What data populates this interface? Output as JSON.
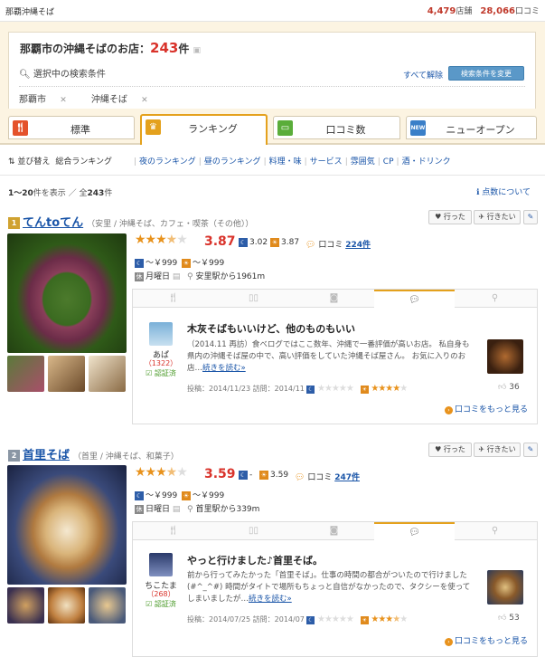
{
  "header": {
    "title": "那覇沖縄そば",
    "shops_count": "4,479",
    "shops_unit": "店舗",
    "reviews_count": "28,066",
    "reviews_unit": "口コミ"
  },
  "search": {
    "heading_prefix": "那覇市の沖縄そばのお店：",
    "count": "243",
    "heading_suffix": "件",
    "conditions_label": "選択中の検索条件",
    "clear_all": "すべて解除",
    "change_conditions": "検索条件を変更",
    "tags": [
      "那覇市",
      "沖縄そば"
    ]
  },
  "tabs": [
    {
      "label": "標準",
      "icon": "fork-knife-icon",
      "color": "#e4522b"
    },
    {
      "label": "ランキング",
      "icon": "crown-icon",
      "color": "#e4a11d",
      "active": true
    },
    {
      "label": "口コミ数",
      "icon": "speech-bubble-icon",
      "color": "#5aad3a"
    },
    {
      "label": "ニューオープン",
      "icon": "new-badge-icon",
      "color": "#3a7fc8"
    }
  ],
  "sort": {
    "label": "並び替え",
    "current": "総合ランキング",
    "options": [
      "夜のランキング",
      "昼のランキング",
      "料理・味",
      "サービス",
      "雰囲気",
      "CP",
      "酒・ドリンク"
    ]
  },
  "results": {
    "range": "1～20",
    "shown_suffix": "件を表示 ／ 全",
    "total": "243",
    "total_suffix": "件",
    "points_link": "点数について"
  },
  "actions": {
    "went": "行った",
    "want": "行きたい"
  },
  "review_tabs": [
    "fork-icon",
    "book-icon",
    "camera-icon",
    "speech-bubble-icon",
    "map-pin-icon"
  ],
  "restaurants": [
    {
      "name": "てんtoてん",
      "genre": "（安里 / 沖縄そば、カフェ・喫茶（その他））",
      "stars": 3.5,
      "rating": "3.87",
      "night": "3.02",
      "day": "3.87",
      "reviews_label": "口コミ",
      "reviews": "224件",
      "price_night": "～￥999",
      "price_day": "～￥999",
      "holiday": "月曜日",
      "access": "安里駅から1961m",
      "review": {
        "user": "あぱ",
        "user_count": "（1322）",
        "verified": "認証済",
        "title": "木灰そばもいいけど、他のものもいい",
        "body": "（2014.11 再訪）食べログではここ数年、沖縄で一番評価が高いお店。 私自身も県内の沖縄そば屋の中で、高い評価をしていた沖縄そば屋さん。 お気に入りのお店…",
        "more": "続きを読む»",
        "posted": "投稿：2014/11/23",
        "visited": "訪問：2014/11",
        "score_stars": 4,
        "likes": "36",
        "see_more": "口コミをもっと見る"
      }
    },
    {
      "name": "首里そば",
      "genre": "（首里 / 沖縄そば、和菓子）",
      "stars": 3.5,
      "rating": "3.59",
      "night": "-",
      "day": "3.59",
      "reviews_label": "口コミ",
      "reviews": "247件",
      "price_night": "～￥999",
      "price_day": "～￥999",
      "holiday": "日曜日",
      "access": "首里駅から339m",
      "review": {
        "user": "ちこたま",
        "user_count": "（268）",
        "verified": "認証済",
        "title": "やっと行けました♪首里そば。",
        "body": "前から行ってみたかった「首里そば」。仕事の時間の都合がついたので行けました(#^_^#) 時間がタイトで場所もちょっと自信がなかったので、タクシーを使ってしまいましたが…",
        "more": "続きを読む»",
        "posted": "投稿：2014/07/25",
        "visited": "訪問：2014/07",
        "score_stars": 3.5,
        "likes": "53",
        "see_more": "口コミをもっと見る"
      }
    }
  ]
}
